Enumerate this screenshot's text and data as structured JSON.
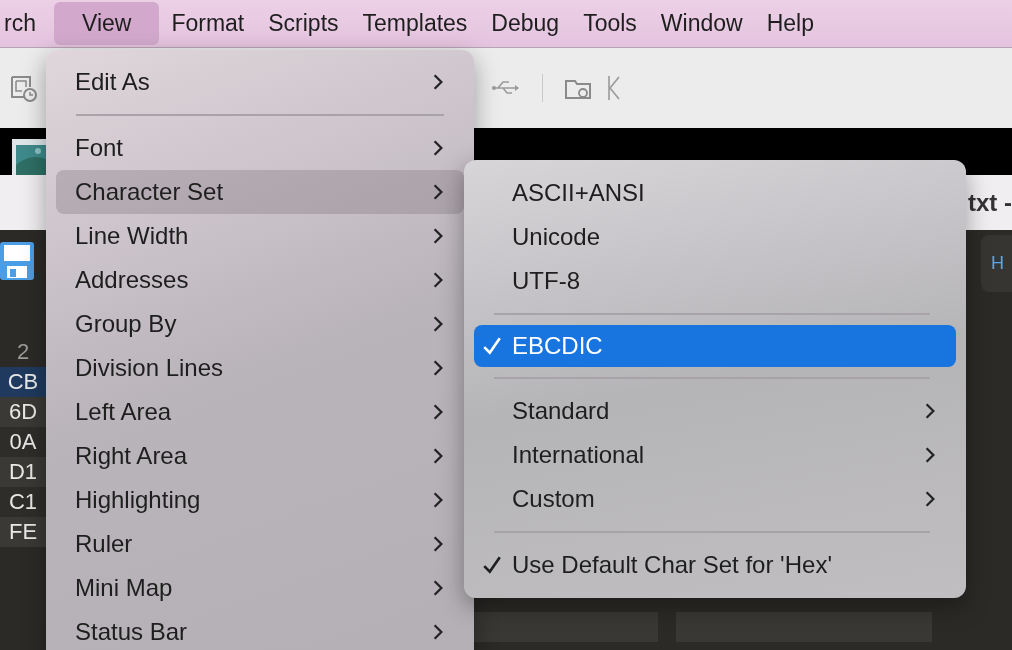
{
  "menubar": {
    "items": [
      {
        "label": "rch",
        "selected": false
      },
      {
        "label": "View",
        "selected": true
      },
      {
        "label": "Format",
        "selected": false
      },
      {
        "label": "Scripts",
        "selected": false
      },
      {
        "label": "Templates",
        "selected": false
      },
      {
        "label": "Debug",
        "selected": false
      },
      {
        "label": "Tools",
        "selected": false
      },
      {
        "label": "Window",
        "selected": false
      },
      {
        "label": "Help",
        "selected": false
      }
    ]
  },
  "window": {
    "title": "txt -"
  },
  "editor": {
    "column_header": "2",
    "rows": [
      {
        "text": "CB",
        "selected": true
      },
      {
        "text": "6D",
        "selected": false
      },
      {
        "text": "0A",
        "selected": false
      },
      {
        "text": "D1",
        "selected": false
      },
      {
        "text": "C1",
        "selected": false
      },
      {
        "text": "FE",
        "selected": false
      }
    ],
    "side_tab": "H"
  },
  "view_menu": {
    "items": [
      {
        "kind": "item",
        "label": "Edit As",
        "submenu": true,
        "selected": false
      },
      {
        "kind": "separator"
      },
      {
        "kind": "item",
        "label": "Font",
        "submenu": true,
        "selected": false
      },
      {
        "kind": "item",
        "label": "Character Set",
        "submenu": true,
        "selected": true
      },
      {
        "kind": "item",
        "label": "Line Width",
        "submenu": true,
        "selected": false
      },
      {
        "kind": "item",
        "label": "Addresses",
        "submenu": true,
        "selected": false
      },
      {
        "kind": "item",
        "label": "Group By",
        "submenu": true,
        "selected": false
      },
      {
        "kind": "item",
        "label": "Division Lines",
        "submenu": true,
        "selected": false
      },
      {
        "kind": "item",
        "label": "Left Area",
        "submenu": true,
        "selected": false
      },
      {
        "kind": "item",
        "label": "Right Area",
        "submenu": true,
        "selected": false
      },
      {
        "kind": "item",
        "label": "Highlighting",
        "submenu": true,
        "selected": false
      },
      {
        "kind": "item",
        "label": "Ruler",
        "submenu": true,
        "selected": false
      },
      {
        "kind": "item",
        "label": "Mini Map",
        "submenu": true,
        "selected": false
      },
      {
        "kind": "item",
        "label": "Status Bar",
        "submenu": true,
        "selected": false
      }
    ]
  },
  "character_set_menu": {
    "items": [
      {
        "kind": "item",
        "label": "ASCII+ANSI",
        "checked": false,
        "selected": false,
        "submenu": false
      },
      {
        "kind": "item",
        "label": "Unicode",
        "checked": false,
        "selected": false,
        "submenu": false
      },
      {
        "kind": "item",
        "label": "UTF-8",
        "checked": false,
        "selected": false,
        "submenu": false
      },
      {
        "kind": "separator"
      },
      {
        "kind": "item",
        "label": "EBCDIC",
        "checked": true,
        "selected": true,
        "submenu": false
      },
      {
        "kind": "separator"
      },
      {
        "kind": "item",
        "label": "Standard",
        "checked": false,
        "selected": false,
        "submenu": true
      },
      {
        "kind": "item",
        "label": "International",
        "checked": false,
        "selected": false,
        "submenu": true
      },
      {
        "kind": "item",
        "label": "Custom",
        "checked": false,
        "selected": false,
        "submenu": true
      },
      {
        "kind": "separator"
      },
      {
        "kind": "item",
        "label": "Use Default Char Set for 'Hex'",
        "checked": true,
        "selected": false,
        "submenu": false
      }
    ]
  }
}
